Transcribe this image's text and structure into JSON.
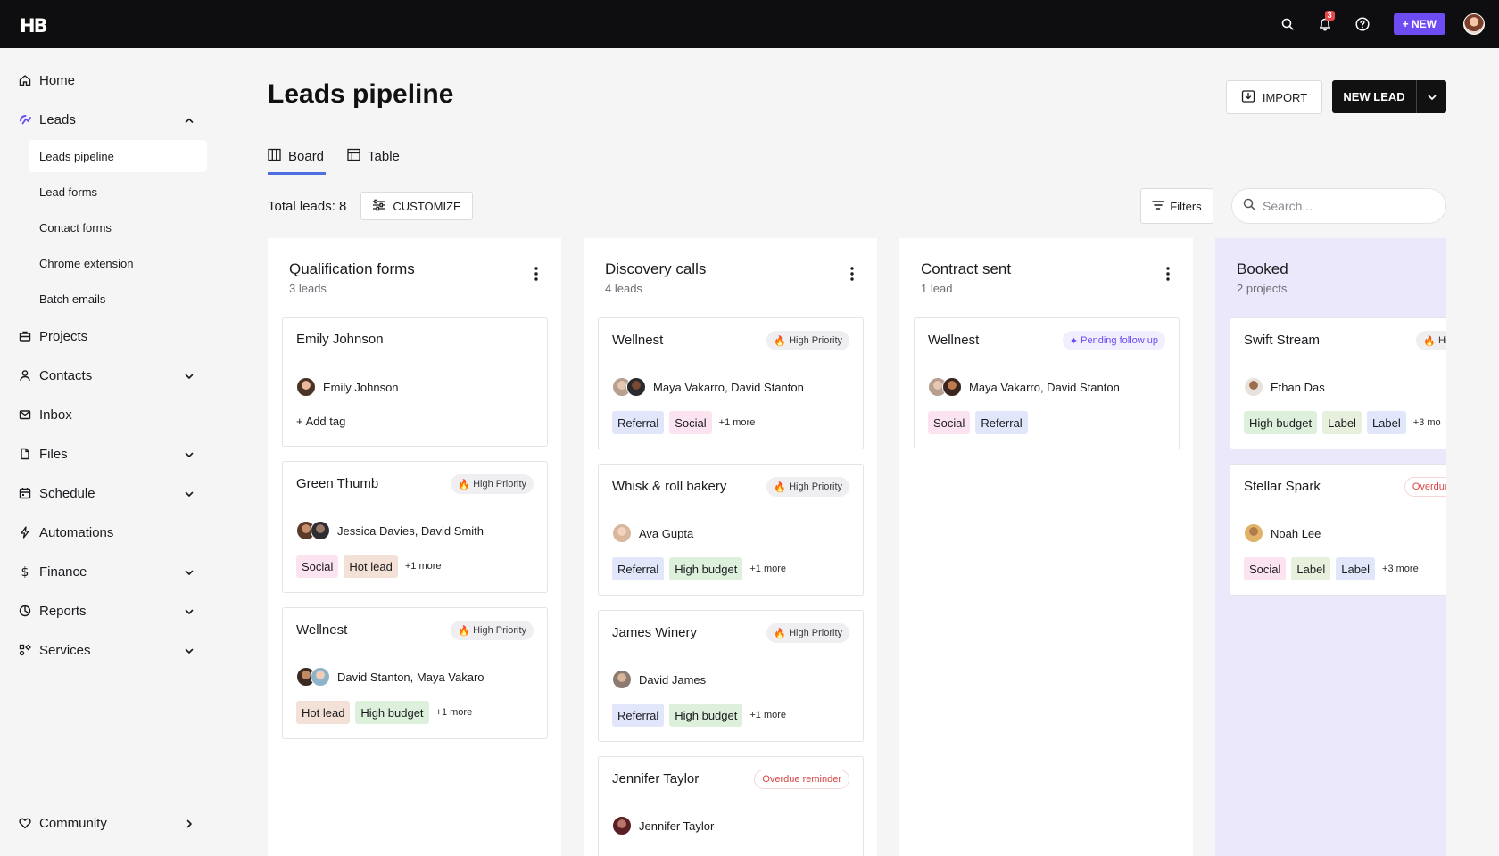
{
  "topbar": {
    "logo": "HB",
    "notification_count": "3",
    "new_button": "+ NEW"
  },
  "sidebar": {
    "items": [
      {
        "label": "Home",
        "icon": "home-icon"
      },
      {
        "label": "Leads",
        "icon": "leads-icon"
      },
      {
        "label": "Projects",
        "icon": "briefcase-icon"
      },
      {
        "label": "Contacts",
        "icon": "person-icon"
      },
      {
        "label": "Inbox",
        "icon": "mail-icon"
      },
      {
        "label": "Files",
        "icon": "file-icon"
      },
      {
        "label": "Schedule",
        "icon": "calendar-icon"
      },
      {
        "label": "Automations",
        "icon": "bolt-icon"
      },
      {
        "label": "Finance",
        "icon": "dollar-icon"
      },
      {
        "label": "Reports",
        "icon": "pie-icon"
      },
      {
        "label": "Services",
        "icon": "services-icon"
      },
      {
        "label": "Community",
        "icon": "heart-icon"
      }
    ],
    "leads_subitems": [
      "Leads pipeline",
      "Lead forms",
      "Contact forms",
      "Chrome extension",
      "Batch emails"
    ]
  },
  "page": {
    "title": "Leads pipeline",
    "import_label": "IMPORT",
    "new_lead_label": "NEW LEAD",
    "tabs": [
      "Board",
      "Table"
    ],
    "total_leads": "Total leads: 8",
    "customize_label": "CUSTOMIZE",
    "filters_label": "Filters",
    "search_placeholder": "Search..."
  },
  "columns": [
    {
      "title": "Qualification forms",
      "subtitle": "3 leads",
      "cards": [
        {
          "title": "Emily Johnson",
          "people": "Emily Johnson",
          "add_tag": "+ Add tag"
        },
        {
          "title": "Green Thumb",
          "badge": "High Priority",
          "people": "Jessica Davies, David Smith",
          "tags": [
            "Social",
            "Hot lead"
          ],
          "more": "+1 more"
        },
        {
          "title": "Wellnest",
          "badge": "High Priority",
          "people": "David Stanton, Maya Vakaro",
          "tags": [
            "Hot lead",
            "High budget"
          ],
          "more": "+1 more"
        }
      ]
    },
    {
      "title": "Discovery calls",
      "subtitle": "4 leads",
      "cards": [
        {
          "title": "Wellnest",
          "badge": "High Priority",
          "people": "Maya Vakarro, David Stanton",
          "tags": [
            "Referral",
            "Social"
          ],
          "more": "+1 more"
        },
        {
          "title": "Whisk & roll bakery",
          "badge": "High Priority",
          "people": "Ava Gupta",
          "tags": [
            "Referral",
            "High budget"
          ],
          "more": "+1 more"
        },
        {
          "title": "James Winery",
          "badge": "High Priority",
          "people": "David James",
          "tags": [
            "Referral",
            "High budget"
          ],
          "more": "+1 more"
        },
        {
          "title": "Jennifer Taylor",
          "badge": "Overdue reminder",
          "people": "Jennifer Taylor"
        }
      ]
    },
    {
      "title": "Contract sent",
      "subtitle": "1 lead",
      "cards": [
        {
          "title": "Wellnest",
          "badge": "Pending follow up",
          "people": "Maya Vakarro, David Stanton",
          "tags": [
            "Social",
            "Referral"
          ]
        }
      ]
    },
    {
      "title": "Booked",
      "subtitle": "2 projects",
      "cards": [
        {
          "title": "Swift Stream",
          "badge": "High P",
          "people": "Ethan Das",
          "tags": [
            "High budget",
            "Label",
            "Label"
          ],
          "more": "+3 mo"
        },
        {
          "title": "Stellar Spark",
          "badge": "Overdue ren",
          "people": "Noah Lee",
          "tags": [
            "Social",
            "Label",
            "Label"
          ],
          "more": "+3 more"
        }
      ]
    }
  ]
}
